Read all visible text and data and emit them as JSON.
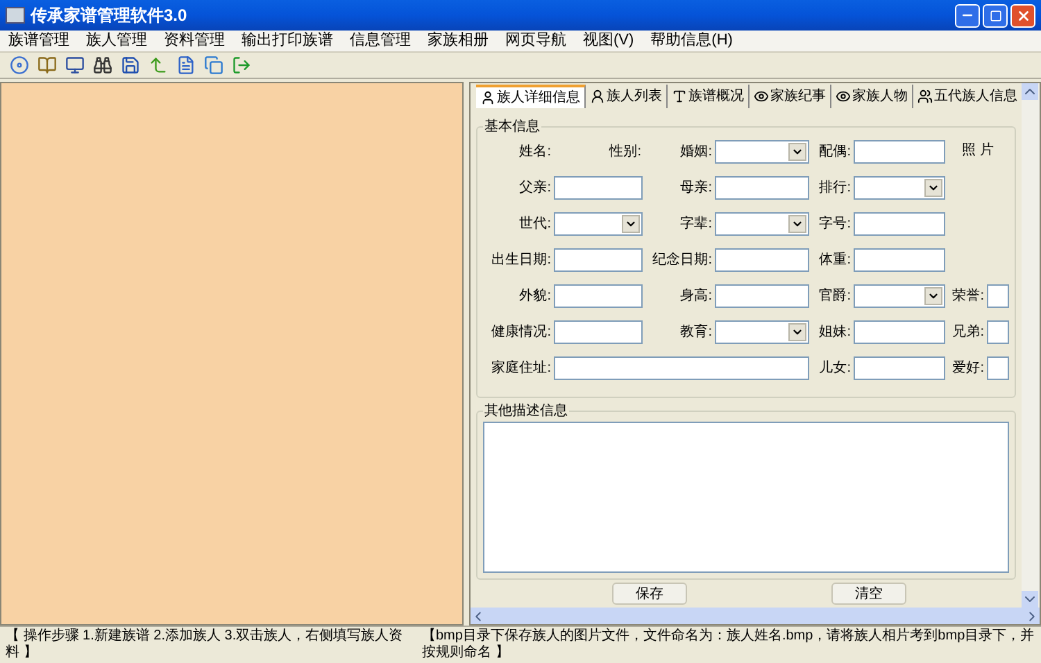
{
  "window": {
    "title": "传承家谱管理软件3.0"
  },
  "menu": [
    "族谱管理",
    "族人管理",
    "资料管理",
    "输出打印族谱",
    "信息管理",
    "家族相册",
    "网页导航",
    "视图(V)",
    "帮助信息(H)"
  ],
  "tabs": [
    {
      "label": "族人详细信息",
      "selected": true
    },
    {
      "label": "族人列表",
      "selected": false
    },
    {
      "label": "族谱概况",
      "selected": false
    },
    {
      "label": "家族纪事",
      "selected": false
    },
    {
      "label": "家族人物",
      "selected": false
    },
    {
      "label": "五代族人信息",
      "selected": false
    }
  ],
  "basic_info": {
    "title": "基本信息",
    "rows": [
      [
        {
          "label": "姓名:",
          "kind": "label_pair",
          "label_2": "性别:"
        },
        {
          "label": "婚姻:",
          "kind": "select"
        },
        {
          "label": "配偶:",
          "kind": "text"
        },
        {
          "label": "照 片",
          "kind": "caption"
        }
      ],
      [
        {
          "label": "父亲:",
          "kind": "text"
        },
        {
          "label": "母亲:",
          "kind": "text"
        },
        {
          "label": "排行:",
          "kind": "select"
        }
      ],
      [
        {
          "label": "世代:",
          "kind": "select"
        },
        {
          "label": "字辈:",
          "kind": "select"
        },
        {
          "label": "字号:",
          "kind": "text"
        }
      ],
      [
        {
          "label": "出生日期:",
          "kind": "text"
        },
        {
          "label": "纪念日期:",
          "kind": "text"
        },
        {
          "label": "体重:",
          "kind": "text"
        }
      ],
      [
        {
          "label": "外貌:",
          "kind": "text"
        },
        {
          "label": "身高:",
          "kind": "text"
        },
        {
          "label": "官爵:",
          "kind": "select"
        },
        {
          "label": "荣誉:",
          "kind": "text"
        }
      ],
      [
        {
          "label": "健康情况:",
          "kind": "text"
        },
        {
          "label": "教育:",
          "kind": "select"
        },
        {
          "label": "姐妹:",
          "kind": "text"
        },
        {
          "label": "兄弟:",
          "kind": "text"
        }
      ],
      [
        {
          "label": "家庭住址:",
          "kind": "wide"
        },
        {
          "kind": "continued"
        },
        {
          "label": "儿女:",
          "kind": "text"
        },
        {
          "label": "爱好:",
          "kind": "text"
        }
      ]
    ]
  },
  "other_info": {
    "title": "其他描述信息"
  },
  "buttons": [
    "保存",
    "清空"
  ],
  "status_bar": [
    "【 操作步骤 1.新建族谱 2.添加族人 3.双击族人，右侧填写族人资料 】",
    "【bmp目录下保存族人的图片文件，文件命名为：族人姓名.bmp，请将族人相片考到bmp目录下，并按规则命名 】"
  ]
}
